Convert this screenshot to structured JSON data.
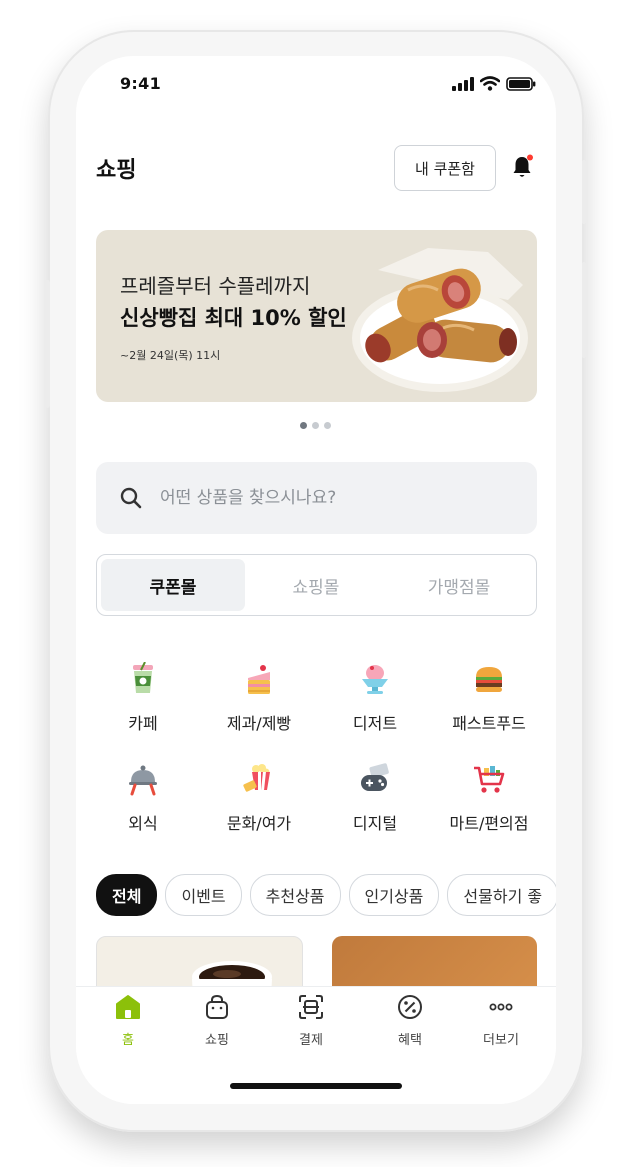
{
  "status_bar": {
    "time": "9:41"
  },
  "header": {
    "title": "쇼핑",
    "coupon_button": "내 쿠폰함"
  },
  "banner": {
    "subtitle": "프레즐부터 수플레까지",
    "title": "신상빵집 최대 10% 할인",
    "date": "~2월 24일(목) 11시",
    "page_count": 3,
    "active_page": 1
  },
  "search": {
    "placeholder": "어떤 상품을 찾으시나요?"
  },
  "segments": [
    {
      "label": "쿠폰몰",
      "active": true
    },
    {
      "label": "쇼핑몰",
      "active": false
    },
    {
      "label": "가맹점몰",
      "active": false
    }
  ],
  "categories": [
    {
      "label": "카페",
      "icon": "cafe-cup-icon"
    },
    {
      "label": "제과/제빵",
      "icon": "cake-icon"
    },
    {
      "label": "디저트",
      "icon": "shaved-ice-icon"
    },
    {
      "label": "패스트푸드",
      "icon": "burger-icon"
    },
    {
      "label": "외식",
      "icon": "dining-icon"
    },
    {
      "label": "문화/여가",
      "icon": "popcorn-icon"
    },
    {
      "label": "디지털",
      "icon": "game-controller-icon"
    },
    {
      "label": "마트/편의점",
      "icon": "shopping-cart-icon"
    }
  ],
  "filter_chips": [
    {
      "label": "전체",
      "active": true
    },
    {
      "label": "이벤트",
      "active": false
    },
    {
      "label": "추천상품",
      "active": false
    },
    {
      "label": "인기상품",
      "active": false
    },
    {
      "label": "선물하기 좋",
      "active": false
    }
  ],
  "bottom_nav": [
    {
      "label": "홈",
      "icon": "home-icon",
      "active": true
    },
    {
      "label": "쇼핑",
      "icon": "shopping-bag-icon",
      "active": false
    },
    {
      "label": "결제",
      "icon": "scan-pay-icon",
      "active": false
    },
    {
      "label": "혜택",
      "icon": "percent-badge-icon",
      "active": false
    },
    {
      "label": "더보기",
      "icon": "more-dots-icon",
      "active": false
    }
  ],
  "colors": {
    "accent": "#8cc00a",
    "notification_dot": "#ff3b30",
    "active_chip": "#111111"
  }
}
